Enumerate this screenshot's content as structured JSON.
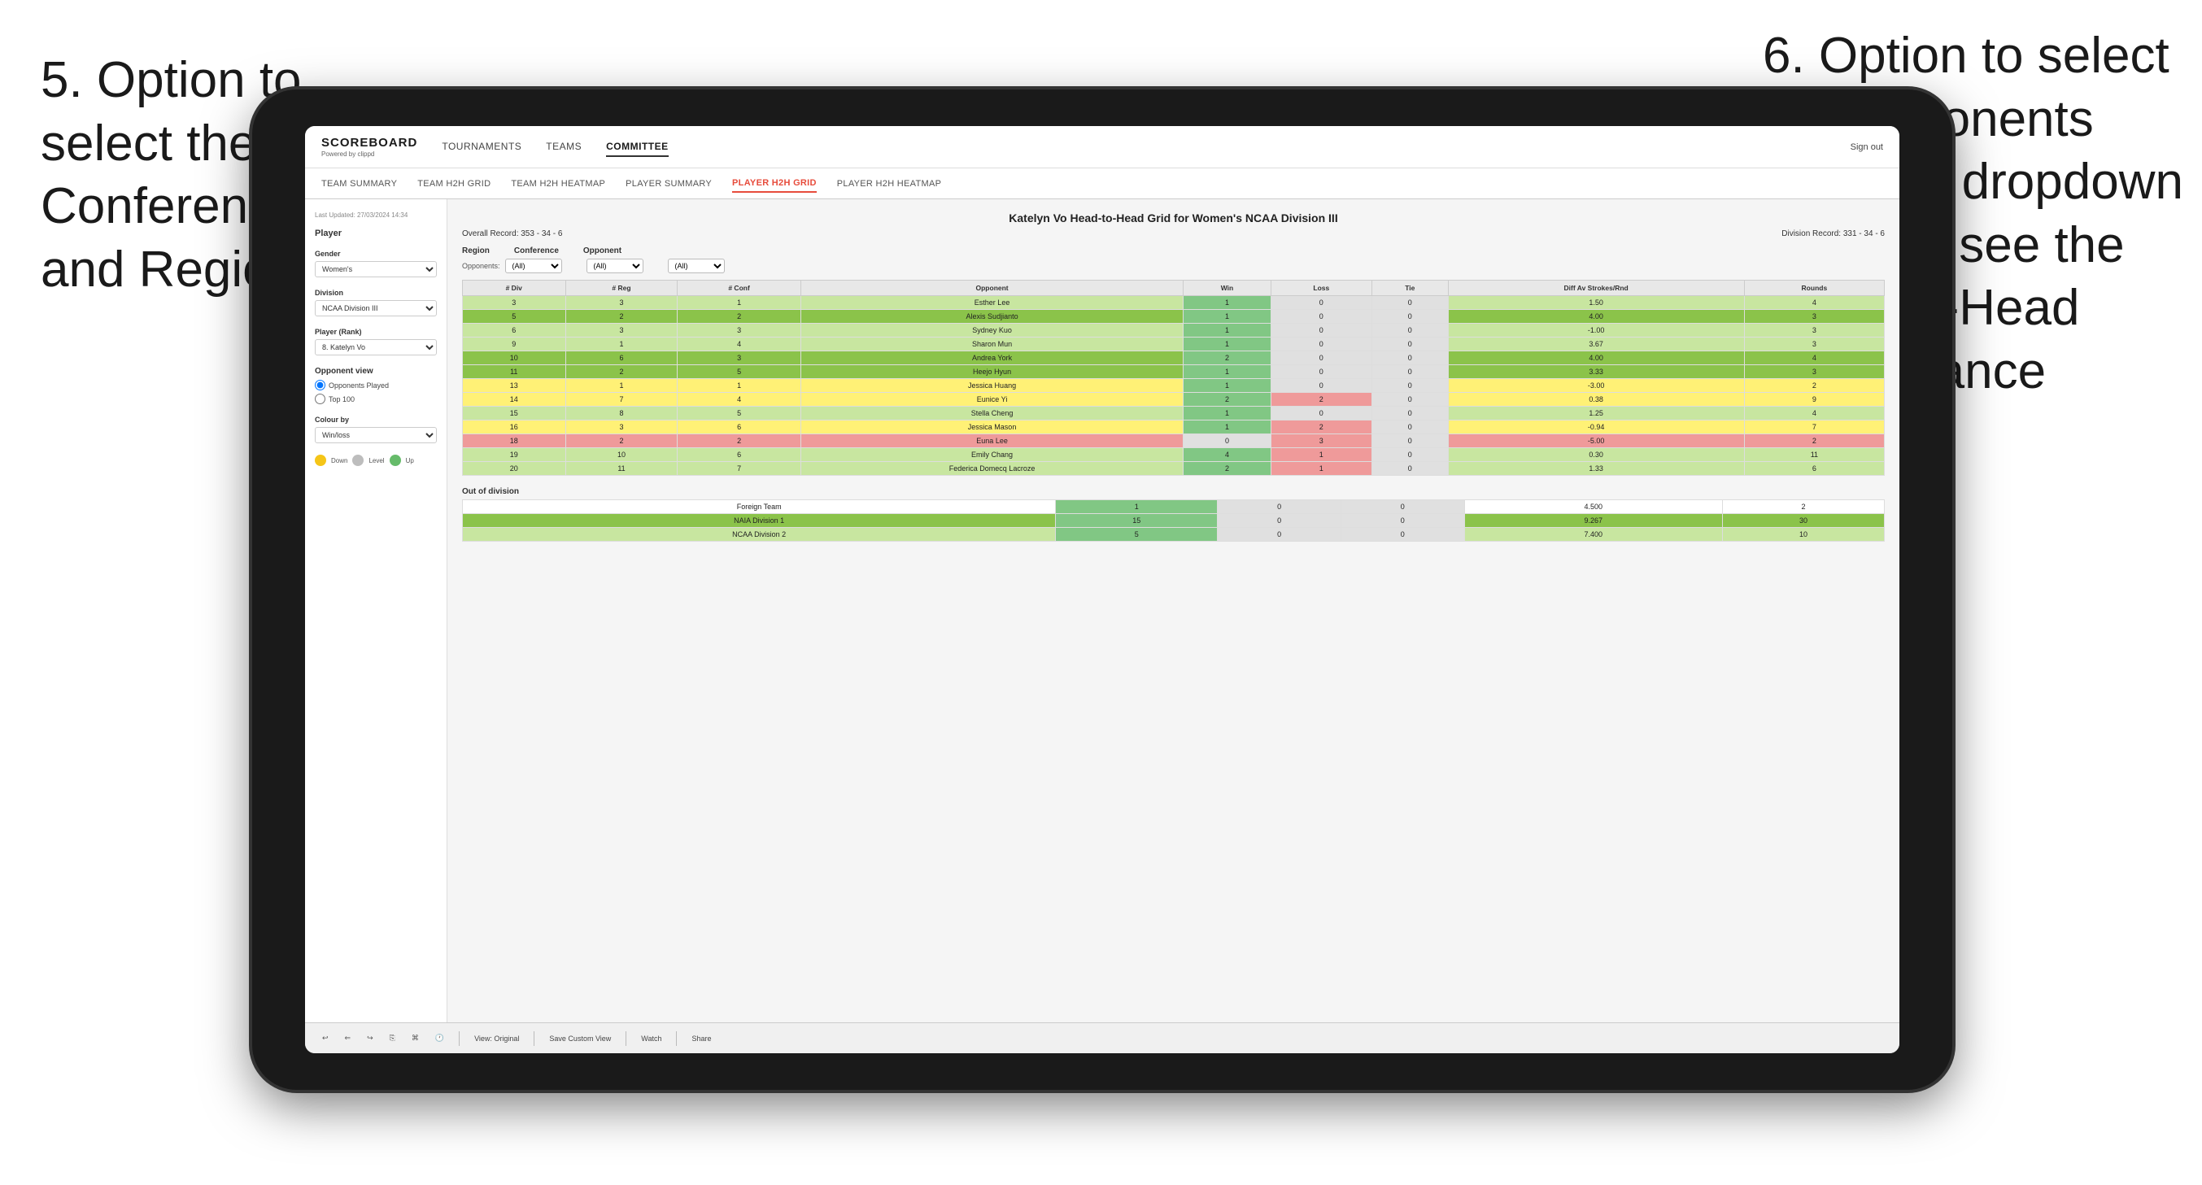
{
  "annotations": {
    "left_title": "5. Option to select the Conference and Region",
    "right_title": "6. Option to select the Opponents from the dropdown menu to see the Head-to-Head performance"
  },
  "nav": {
    "logo": "SCOREBOARD",
    "logo_sub": "Powered by clippd",
    "items": [
      "TOURNAMENTS",
      "TEAMS",
      "COMMITTEE"
    ],
    "sign_out": "Sign out"
  },
  "sub_nav": {
    "items": [
      "TEAM SUMMARY",
      "TEAM H2H GRID",
      "TEAM H2H HEATMAP",
      "PLAYER SUMMARY",
      "PLAYER H2H GRID",
      "PLAYER H2H HEATMAP"
    ],
    "active": "PLAYER H2H GRID"
  },
  "sidebar": {
    "last_updated": "Last Updated: 27/03/2024 14:34",
    "player_label": "Player",
    "gender_label": "Gender",
    "gender_value": "Women's",
    "division_label": "Division",
    "division_value": "NCAA Division III",
    "player_rank_label": "Player (Rank)",
    "player_rank_value": "8. Katelyn Vo",
    "opponent_view_label": "Opponent view",
    "opponents_played": "Opponents Played",
    "top_100": "Top 100",
    "colour_by_label": "Colour by",
    "colour_by_value": "Win/loss",
    "legend": {
      "down": "Down",
      "level": "Level",
      "up": "Up"
    }
  },
  "main": {
    "title": "Katelyn Vo Head-to-Head Grid for Women's NCAA Division III",
    "overall_record": "Overall Record: 353 - 34 - 6",
    "division_record": "Division Record: 331 - 34 - 6",
    "region_filter_label": "Region",
    "conf_filter_label": "Conference",
    "opponent_filter_label": "Opponent",
    "opponents_label": "Opponents:",
    "filter_all": "(All)",
    "columns": [
      "# Div",
      "# Reg",
      "# Conf",
      "Opponent",
      "Win",
      "Loss",
      "Tie",
      "Diff Av Strokes/Rnd",
      "Rounds"
    ],
    "rows": [
      {
        "div": "3",
        "reg": "3",
        "conf": "1",
        "opponent": "Esther Lee",
        "win": "1",
        "loss": "0",
        "tie": "0",
        "diff": "1.50",
        "rounds": "4",
        "color": "green_light"
      },
      {
        "div": "5",
        "reg": "2",
        "conf": "2",
        "opponent": "Alexis Sudjianto",
        "win": "1",
        "loss": "0",
        "tie": "0",
        "diff": "4.00",
        "rounds": "3",
        "color": "green_med"
      },
      {
        "div": "6",
        "reg": "3",
        "conf": "3",
        "opponent": "Sydney Kuo",
        "win": "1",
        "loss": "0",
        "tie": "0",
        "diff": "-1.00",
        "rounds": "3",
        "color": "green_light"
      },
      {
        "div": "9",
        "reg": "1",
        "conf": "4",
        "opponent": "Sharon Mun",
        "win": "1",
        "loss": "0",
        "tie": "0",
        "diff": "3.67",
        "rounds": "3",
        "color": "green_light"
      },
      {
        "div": "10",
        "reg": "6",
        "conf": "3",
        "opponent": "Andrea York",
        "win": "2",
        "loss": "0",
        "tie": "0",
        "diff": "4.00",
        "rounds": "4",
        "color": "green_med"
      },
      {
        "div": "11",
        "reg": "2",
        "conf": "5",
        "opponent": "Heejo Hyun",
        "win": "1",
        "loss": "0",
        "tie": "0",
        "diff": "3.33",
        "rounds": "3",
        "color": "green_med"
      },
      {
        "div": "13",
        "reg": "1",
        "conf": "1",
        "opponent": "Jessica Huang",
        "win": "1",
        "loss": "0",
        "tie": "0",
        "diff": "-3.00",
        "rounds": "2",
        "color": "yellow"
      },
      {
        "div": "14",
        "reg": "7",
        "conf": "4",
        "opponent": "Eunice Yi",
        "win": "2",
        "loss": "2",
        "tie": "0",
        "diff": "0.38",
        "rounds": "9",
        "color": "yellow"
      },
      {
        "div": "15",
        "reg": "8",
        "conf": "5",
        "opponent": "Stella Cheng",
        "win": "1",
        "loss": "0",
        "tie": "0",
        "diff": "1.25",
        "rounds": "4",
        "color": "green_light"
      },
      {
        "div": "16",
        "reg": "3",
        "conf": "6",
        "opponent": "Jessica Mason",
        "win": "1",
        "loss": "2",
        "tie": "0",
        "diff": "-0.94",
        "rounds": "7",
        "color": "yellow"
      },
      {
        "div": "18",
        "reg": "2",
        "conf": "2",
        "opponent": "Euna Lee",
        "win": "0",
        "loss": "3",
        "tie": "0",
        "diff": "-5.00",
        "rounds": "2",
        "color": "red_light"
      },
      {
        "div": "19",
        "reg": "10",
        "conf": "6",
        "opponent": "Emily Chang",
        "win": "4",
        "loss": "1",
        "tie": "0",
        "diff": "0.30",
        "rounds": "11",
        "color": "green_light"
      },
      {
        "div": "20",
        "reg": "11",
        "conf": "7",
        "opponent": "Federica Domecq Lacroze",
        "win": "2",
        "loss": "1",
        "tie": "0",
        "diff": "1.33",
        "rounds": "6",
        "color": "green_light"
      }
    ],
    "out_of_division_label": "Out of division",
    "out_of_division_rows": [
      {
        "name": "Foreign Team",
        "win": "1",
        "loss": "0",
        "tie": "0",
        "diff": "4.500",
        "rounds": "2",
        "color": "white"
      },
      {
        "name": "NAIA Division 1",
        "win": "15",
        "loss": "0",
        "tie": "0",
        "diff": "9.267",
        "rounds": "30",
        "color": "green_med"
      },
      {
        "name": "NCAA Division 2",
        "win": "5",
        "loss": "0",
        "tie": "0",
        "diff": "7.400",
        "rounds": "10",
        "color": "green_light"
      }
    ]
  },
  "toolbar": {
    "view_original": "View: Original",
    "save_custom_view": "Save Custom View",
    "watch": "Watch",
    "share": "Share"
  }
}
